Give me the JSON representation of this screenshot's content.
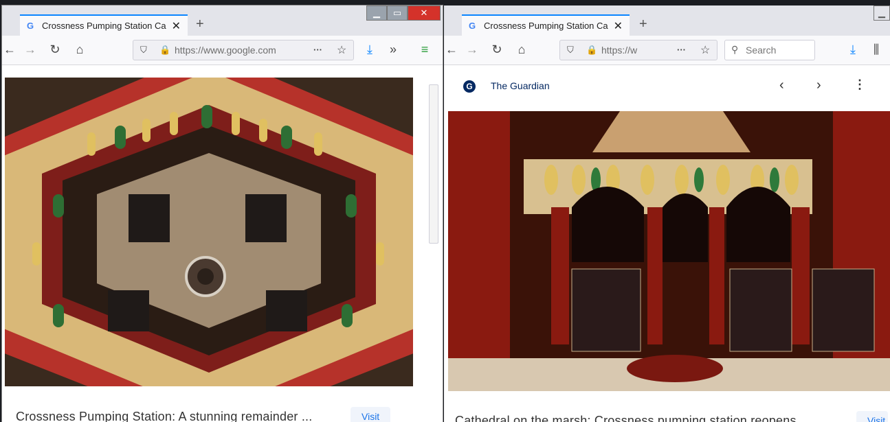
{
  "left_window": {
    "tab_title": "Crossness Pumping Station Ca",
    "url": "https://www.google.com",
    "caption": "Crossness Pumping Station: A stunning remainder ...",
    "visit_label": "Visit"
  },
  "right_window": {
    "tab_title": "Crossness Pumping Station Ca",
    "url": "https://w",
    "search_placeholder": "Search",
    "source_name": "The Guardian",
    "caption": "Cathedral on the marsh: Crossness pumping station reopens ...",
    "visit_label": "Visit"
  },
  "icons": [
    "google-favicon",
    "close-icon",
    "new-tab-icon",
    "back-icon",
    "forward-icon",
    "reload-icon",
    "home-icon",
    "shield-icon",
    "lock-icon",
    "more-icon",
    "star-icon",
    "download-icon",
    "overflow-icon",
    "extension-icon",
    "search-icon",
    "library-icon",
    "guardian-logo-icon",
    "chevron-left-icon",
    "chevron-right-icon",
    "kebab-menu-icon"
  ],
  "colors": {
    "accent": "#0a84ff",
    "link": "#1a73e8",
    "close_red": "#d4322a"
  }
}
